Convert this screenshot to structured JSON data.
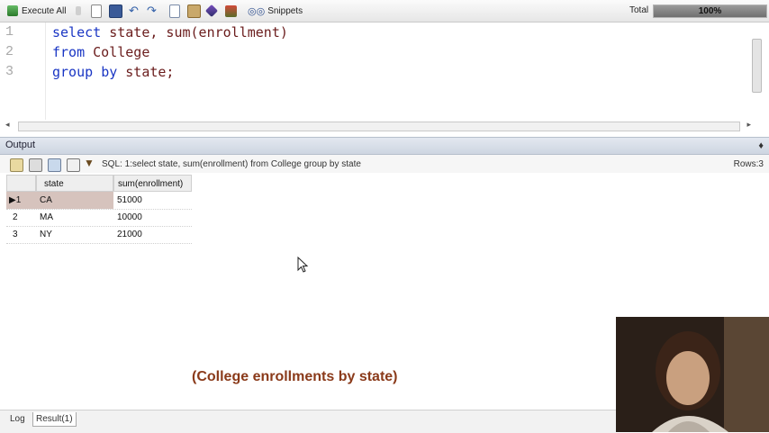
{
  "toolbar": {
    "execute_all": "Execute All",
    "snippets": "Snippets",
    "total_label": "Total",
    "progress_text": "100%",
    "progress_fraction": 1.0
  },
  "editor": {
    "line_numbers": [
      "1",
      "2",
      "3"
    ],
    "lines": [
      [
        {
          "t": "select",
          "c": "kw"
        },
        {
          "t": " state, sum(enrollment)",
          "c": "idf"
        }
      ],
      [
        {
          "t": "from",
          "c": "kw"
        },
        {
          "t": " College",
          "c": "idf"
        }
      ],
      [
        {
          "t": "group",
          "c": "kw"
        },
        {
          "t": " ",
          "c": "idf"
        },
        {
          "t": "by",
          "c": "kw"
        },
        {
          "t": " state;",
          "c": "idf"
        }
      ]
    ]
  },
  "output": {
    "title": "Output",
    "sql_text": "SQL: 1:select state, sum(enrollment) from College group by state",
    "rows_text": "Rows:3"
  },
  "results": {
    "columns": [
      "state",
      "sum(enrollment)"
    ],
    "row_numbers": [
      "▶1",
      "2",
      "3"
    ],
    "rows": [
      [
        "CA",
        "51000"
      ],
      [
        "MA",
        "10000"
      ],
      [
        "NY",
        "21000"
      ]
    ]
  },
  "caption": "(College enrollments by state)",
  "tabs": [
    "Log",
    "Result(1)"
  ]
}
